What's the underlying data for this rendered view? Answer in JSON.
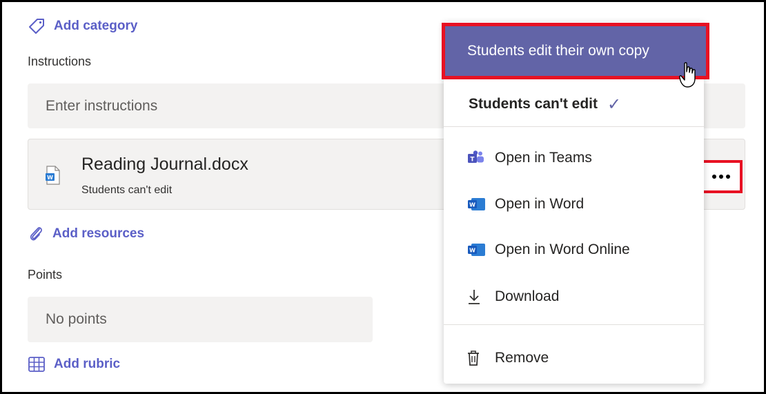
{
  "form": {
    "add_category": "Add category",
    "instructions_label": "Instructions",
    "instructions_placeholder": "Enter instructions",
    "resource": {
      "name": "Reading Journal.docx",
      "permission": "Students can't edit"
    },
    "add_resources": "Add resources",
    "points_label": "Points",
    "points_value": "No points",
    "add_rubric": "Add rubric"
  },
  "menu": {
    "highlighted": "Students edit their own copy",
    "selected": "Students can't edit",
    "items": [
      {
        "label": "Open in Teams",
        "icon": "teams-icon"
      },
      {
        "label": "Open in Word",
        "icon": "word-icon"
      },
      {
        "label": "Open in Word Online",
        "icon": "word-icon"
      },
      {
        "label": "Download",
        "icon": "download-icon"
      }
    ],
    "remove": "Remove"
  },
  "colors": {
    "accent": "#5b5fc7",
    "menu_highlight": "#6264a7",
    "annotation": "#e81123",
    "field_bg": "#f3f2f1"
  }
}
